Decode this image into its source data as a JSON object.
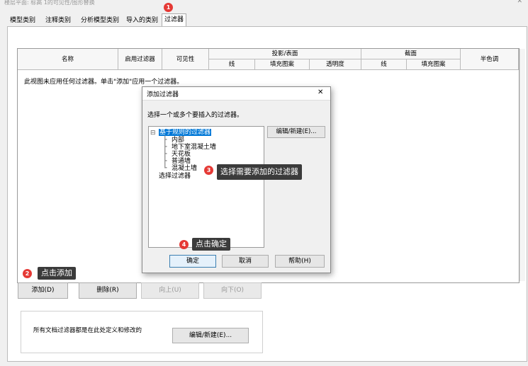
{
  "window": {
    "title": "楼层平面: 标高 1的可见性/图形替换",
    "close_glyph": "✕"
  },
  "tabs": [
    {
      "label": "模型类别"
    },
    {
      "label": "注释类别"
    },
    {
      "label": "分析模型类别"
    },
    {
      "label": "导入的类别"
    },
    {
      "label": "过滤器"
    }
  ],
  "table": {
    "col_name": "名称",
    "col_enable": "启用过滤器",
    "col_visibility": "可见性",
    "col_projection": "投影/表面",
    "col_cut": "截面",
    "col_halftone": "半色调",
    "proj_sub": [
      "线",
      "填充图案",
      "透明度"
    ],
    "cut_sub": [
      "线",
      "填充图案"
    ],
    "empty_message": "此视图未应用任何过滤器。单击\"添加\"应用一个过滤器。"
  },
  "buttons": {
    "add": "添加(D)",
    "remove": "删除(R)",
    "up": "向上(U)",
    "down": "向下(O)",
    "edit_new": "编辑/新建(E)..."
  },
  "group": {
    "text": "所有文档过滤器都是在此处定义和修改的"
  },
  "dialog": {
    "title": "添加过滤器",
    "close_glyph": "✕",
    "prompt": "选择一个或多个要插入的过滤器。",
    "edit_new": "编辑/新建(E)...",
    "ok": "确定",
    "cancel": "取消",
    "help": "帮助(H)",
    "tree": {
      "root_rule": "基于规则的过滤器",
      "children": [
        "内部",
        "地下室混凝土墙",
        "天花板",
        "普通墙",
        "混凝土墙"
      ],
      "root_select": "选择过滤器"
    }
  },
  "annotations": {
    "badge1": "1",
    "badge2": "2",
    "badge3": "3",
    "badge4": "4",
    "callout2": "点击添加",
    "callout3": "选择需要添加的过滤器",
    "callout4": "点击确定"
  },
  "colors": {
    "badge": "#e53935",
    "callout_bg": "#3b3b3b",
    "selection": "#0078d7"
  }
}
